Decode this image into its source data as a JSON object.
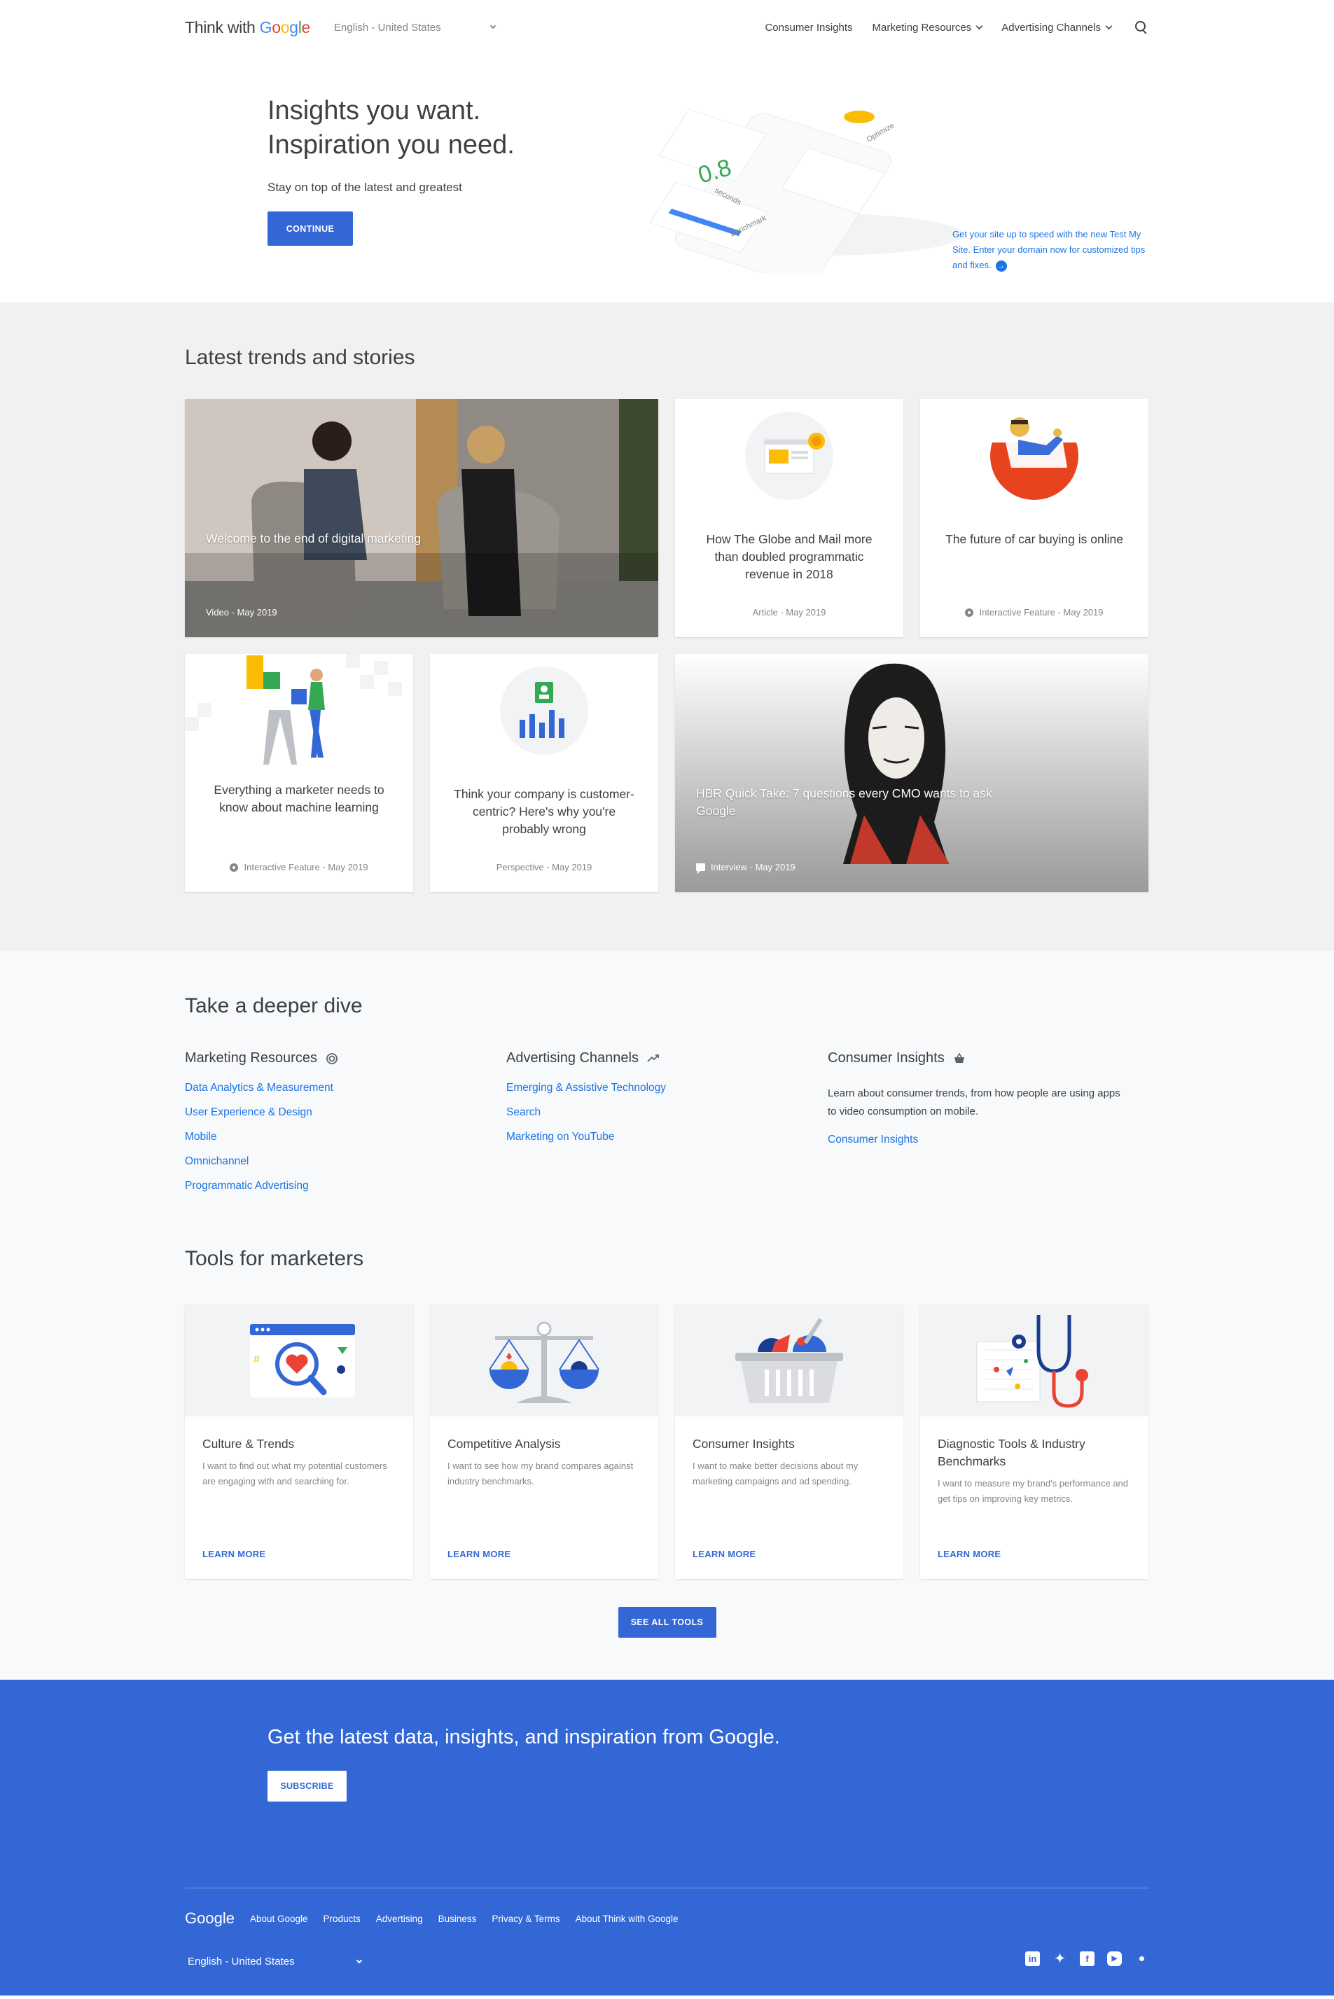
{
  "header": {
    "logo_prefix": "Think with ",
    "logo_brand": [
      "G",
      "o",
      "o",
      "g",
      "l",
      "e"
    ],
    "language": "English - United States",
    "nav": [
      {
        "label": "Consumer Insights"
      },
      {
        "label": "Marketing Resources"
      },
      {
        "label": "Advertising Channels"
      }
    ]
  },
  "hero": {
    "title_line1": "Insights you want.",
    "title_line2": "Inspiration you need.",
    "subtitle": "Stay on top of the latest and greatest",
    "cta": "CONTINUE",
    "art_seconds": "0.8",
    "art_seconds_label": "seconds",
    "art_optimize": "Optimize",
    "art_benchmark": "Benchmark",
    "side_link": "Get your site up to speed with the new Test My Site. Enter your domain now for customized tips and fixes."
  },
  "trends": {
    "title": "Latest trends and stories",
    "cards": [
      {
        "title": "Welcome to the end of digital marketing",
        "meta": "Video - May 2019"
      },
      {
        "title": "How The Globe and Mail more than doubled programmatic revenue in 2018",
        "meta": "Article - May 2019"
      },
      {
        "title": "The future of car buying is online",
        "meta": "Interactive Feature - May 2019"
      },
      {
        "title": "Everything a marketer needs to know about machine learning",
        "meta": "Interactive Feature - May 2019"
      },
      {
        "title": "Think your company is customer-centric? Here's why you're probably wrong",
        "meta": "Perspective - May 2019"
      },
      {
        "title": "HBR Quick Take: 7 questions every CMO wants to ask Google",
        "meta": "Interview - May 2019"
      }
    ]
  },
  "deep": {
    "title": "Take a deeper dive",
    "columns": [
      {
        "heading": "Marketing Resources",
        "links": [
          "Data Analytics & Measurement",
          "User Experience & Design",
          "Mobile",
          "Omnichannel",
          "Programmatic Advertising"
        ]
      },
      {
        "heading": "Advertising Channels",
        "links": [
          "Emerging & Assistive Technology",
          "Search",
          "Marketing on YouTube"
        ]
      },
      {
        "heading": "Consumer Insights",
        "text": "Learn about consumer trends, from how people are using apps to video consumption on mobile.",
        "links": [
          "Consumer Insights"
        ]
      }
    ]
  },
  "tools": {
    "title": "Tools for marketers",
    "cards": [
      {
        "title": "Culture & Trends",
        "desc": "I want to find out what my potential customers are engaging with and searching for.",
        "link": "LEARN MORE"
      },
      {
        "title": "Competitive Analysis",
        "desc": "I want to see how my brand compares against industry benchmarks.",
        "link": "LEARN MORE"
      },
      {
        "title": "Consumer Insights",
        "desc": "I want to make better decisions about my marketing campaigns and ad spending.",
        "link": "LEARN MORE"
      },
      {
        "title": "Diagnostic Tools & Industry Benchmarks",
        "desc": "I want to measure my brand's performance and get tips on improving key metrics.",
        "link": "LEARN MORE"
      }
    ],
    "see_all": "SEE ALL TOOLS"
  },
  "footer": {
    "subscribe_title": "Get the latest data, insights, and inspiration from Google.",
    "subscribe_button": "SUBSCRIBE",
    "logo": "Google",
    "links": [
      "About Google",
      "Products",
      "Advertising",
      "Business",
      "Privacy & Terms",
      "About Think with Google"
    ],
    "language": "English - United States",
    "social": [
      "linkedin-icon",
      "twitter-icon",
      "facebook-icon",
      "youtube-icon",
      "rss-icon"
    ]
  },
  "colors": {
    "accent": "#3367d6",
    "link": "#1a73e8",
    "section_bg": "#f1f1f1"
  }
}
